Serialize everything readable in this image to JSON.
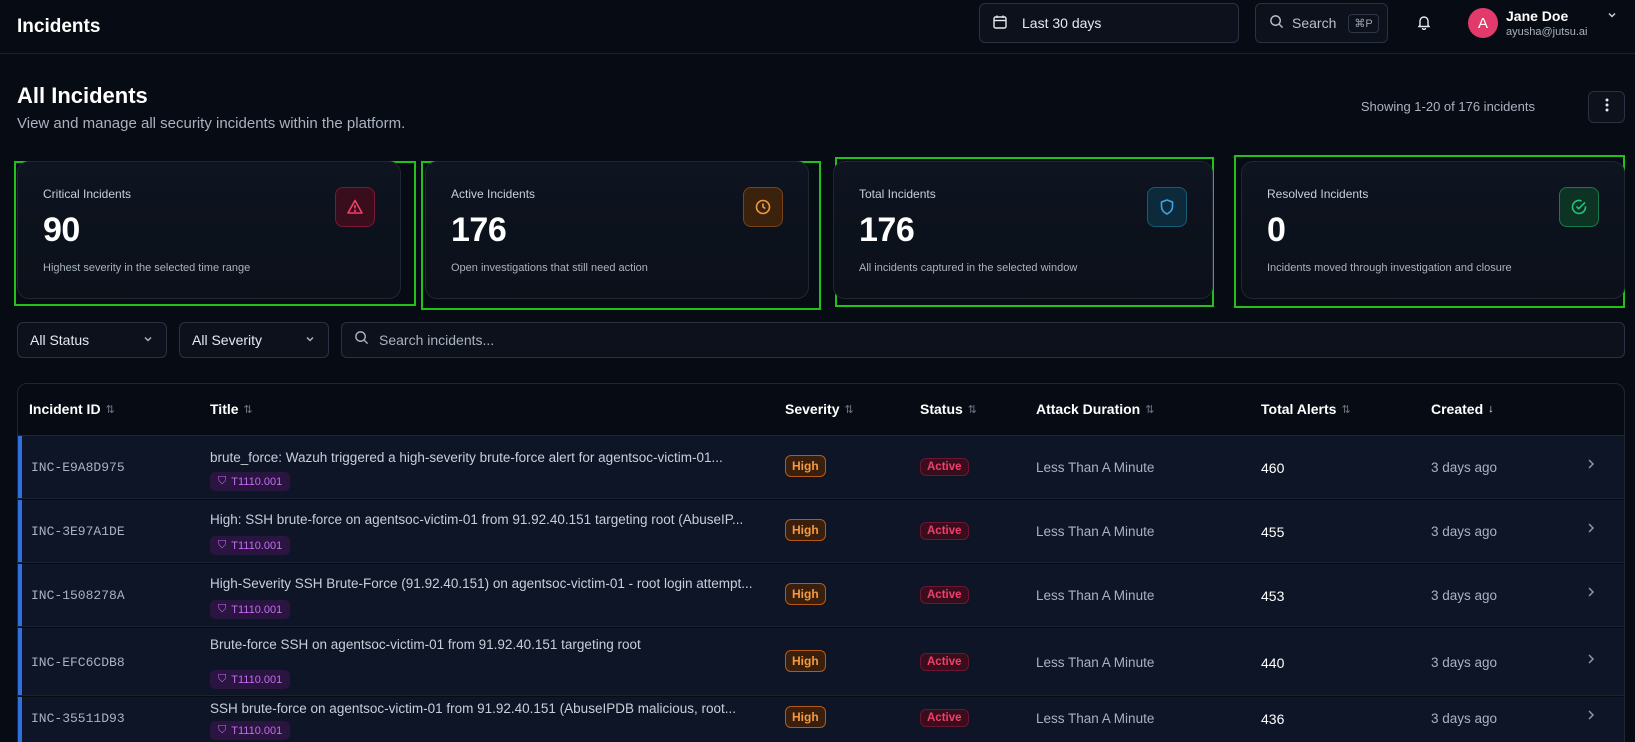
{
  "app": {
    "title": "Incidents"
  },
  "header": {
    "date_range": "Last 30 days",
    "search_label": "Search",
    "search_shortcut": "⌘P",
    "user": {
      "initial": "A",
      "name": "Jane Doe",
      "email": "ayusha@jutsu.ai"
    }
  },
  "page": {
    "title": "All Incidents",
    "subtitle": "View and manage all security incidents within the platform.",
    "showing": "Showing 1-20 of 176 incidents"
  },
  "stats": [
    {
      "label": "Critical Incidents",
      "value": "90",
      "desc": "Highest severity in the selected time range",
      "icon": "alert-triangle-icon",
      "color": "#e0245e"
    },
    {
      "label": "Active Incidents",
      "value": "176",
      "desc": "Open investigations that still need action",
      "icon": "clock-icon",
      "color": "#e8892b"
    },
    {
      "label": "Total Incidents",
      "value": "176",
      "desc": "All incidents captured in the selected window",
      "icon": "shield-icon",
      "color": "#3aa7e8"
    },
    {
      "label": "Resolved Incidents",
      "value": "0",
      "desc": "Incidents moved through investigation and closure",
      "icon": "check-circle-icon",
      "color": "#22c37a"
    }
  ],
  "filters": {
    "status": "All Status",
    "severity": "All Severity",
    "search_placeholder": "Search incidents..."
  },
  "table": {
    "columns": [
      "Incident ID",
      "Title",
      "Severity",
      "Status",
      "Attack Duration",
      "Total Alerts",
      "Created"
    ],
    "rows": [
      {
        "id": "INC-E9A8D975",
        "title": "brute_force: Wazuh triggered a high-severity brute-force alert for agentsoc-victim-01...",
        "mitre": "T1110.001",
        "severity": "High",
        "status": "Active",
        "duration": "Less Than A Minute",
        "alerts": "460",
        "created": "3 days ago"
      },
      {
        "id": "INC-3E97A1DE",
        "title": "High: SSH brute-force on agentsoc-victim-01 from 91.92.40.151 targeting root (AbuseIP...",
        "mitre": "T1110.001",
        "severity": "High",
        "status": "Active",
        "duration": "Less Than A Minute",
        "alerts": "455",
        "created": "3 days ago"
      },
      {
        "id": "INC-1508278A",
        "title": "High-Severity SSH Brute-Force (91.92.40.151) on agentsoc-victim-01 - root login attempt...",
        "mitre": "T1110.001",
        "severity": "High",
        "status": "Active",
        "duration": "Less Than A Minute",
        "alerts": "453",
        "created": "3 days ago"
      },
      {
        "id": "INC-EFC6CDB8",
        "title": "Brute-force SSH on agentsoc-victim-01 from 91.92.40.151 targeting root",
        "mitre": "T1110.001",
        "severity": "High",
        "status": "Active",
        "duration": "Less Than A Minute",
        "alerts": "440",
        "created": "3 days ago"
      },
      {
        "id": "INC-35511D93",
        "title": "SSH brute-force on agentsoc-victim-01 from 91.92.40.151 (AbuseIPDB malicious, root...",
        "mitre": "T1110.001",
        "severity": "High",
        "status": "Active",
        "duration": "Less Than A Minute",
        "alerts": "436",
        "created": "3 days ago"
      }
    ]
  }
}
